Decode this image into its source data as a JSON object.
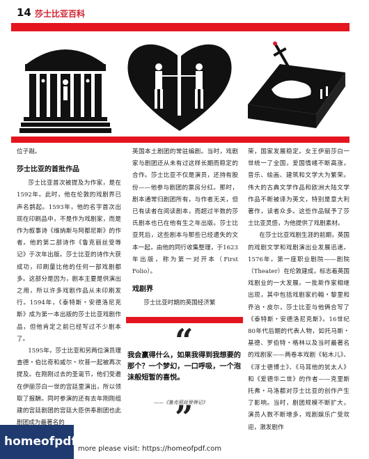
{
  "header": {
    "page_number": "14",
    "title": "莎士比亚百科"
  },
  "illustrations": [
    "temple-icon",
    "heart-swordfight-icon",
    "tombstone-dagger-icon"
  ],
  "colors": {
    "accent": "#e4151f",
    "badge": "#1e3a6e"
  },
  "col1": {
    "top_fragment": "位子剐。",
    "heading": "莎士比亚的首批作品",
    "p1": "莎士比亚首次被提及为作家，是在1592年。此时，他在伦敦的戏剧界已声名鹊起。1593年，他的名字首次出现在印刷品中，不是作为戏剧家，而是作为叙事诗《维纳斯与阿都尼斯》的作者。他的第二部诗作《鲁克丽丝受辱记》于次年出版。莎士比亚的诗作大获成功，印刷量比他的任何一部戏剧都多。这部分是因为，剧本主要是供演出之用，所以许多戏剧作品从未印刷发行。1594年，《泰特斯・安德洛尼克斯》成为第一本出版的莎士比亚戏剧作品，但他肯定之前已经写过不少剧本了。",
    "p2": "1595年，莎士比亚和另两位演员理查德・伯比奇和威尔・坎普一起被再次提及。在刚刚过去的圣诞节，他们受邀在伊丽莎白一世的宫廷里演出，所以领取了报酬。同时参演的还有去年刚刚组建的宫廷剧团的宫廷大臣供奉剧团也此剧团成为最著名的"
  },
  "col2": {
    "p1": "英国本土剧团的常驻编剧。当时，戏剧家与剧团还从未有过这样长期而稳定的合作。莎士比亚不仅是演员，还持有股份——他参与剧团的票房分红。那时，剧本通常归剧团所有，与作者无关，但已有读者在阅读剧本，而超过半数的莎氏剧本也已在他有生之年出版。莎士比亚死后，这些剧本与那些已经遗失的文本一起，由他的同行收集整理，于1623年出版，称为第一对开本（First Folio）。",
    "heading": "戏剧界",
    "p2": "莎士比亚时期的英国经济繁"
  },
  "quote": {
    "open_mark": "“",
    "close_mark": "”",
    "text": "我会赢得什么，如果我得到我想要的那个？一个梦幻，一口呼吸，一个泡沫般短暂的喜悦。",
    "source": "——《鲁克丽丝受辱记》"
  },
  "col3": {
    "p1": "荣，国家发展稳定。女王伊丽莎白一世统一了全国，爱国情绪不断高涨，音乐、绘画、建筑和文学大为繁荣。伟大的古典文学作品和欧洲大陆文学作品不断被译为英文，特别是意大利著作，读者众多。这些作品赋予了莎士比亚灵感，为他提供了戏剧素材。",
    "p2": "在莎士比亚戏剧生涯的前期，英国的戏剧文学和戏剧演出业发展迅速。1576年，第一座职业剧院——剧院（Theater）在伦敦建成，标志着英国戏剧业的一大发展。一批新作家相继出现，其中包括戏剧家约翰・黎里和乔治・皮尔，莎士比亚与他俩合写了《泰特斯・安德洛尼克斯》。16世纪80年代后期的代表人物，如托马斯・基德、罗伯特・格林以及当时最著名的戏剧家——两卷本戏剧《帖木儿》、《浮士德博士》、《马耳他的犹太人》和《爱德华二世》的作者——克里斯托弗・马洛都对莎士比亚的创作产生了影响。当时，剧团规模不断扩大，演员人数不断增多，戏剧娱乐广受欢迎，激发剧作"
  },
  "footer": {
    "site_badge": "homeofpdf.com",
    "visit_text": "more please visit: https://homeofpdf.com"
  }
}
